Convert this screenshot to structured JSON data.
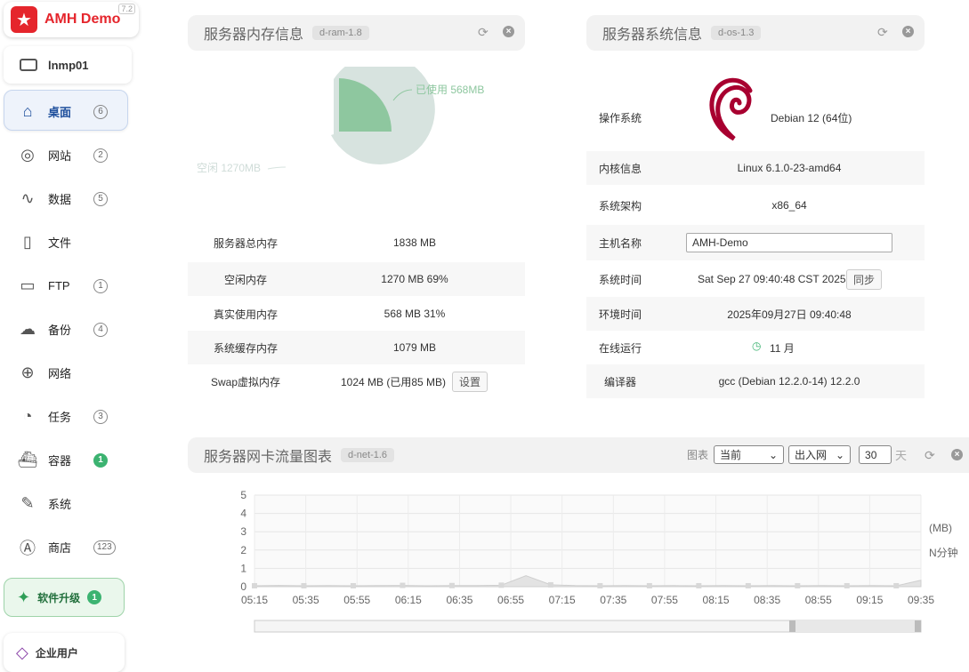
{
  "brand": {
    "title": "AMH Demo",
    "version": "7.2",
    "icon": "star-icon"
  },
  "server": {
    "name": "lnmp01",
    "icon": "server-icon"
  },
  "nav": [
    {
      "label": "桌面",
      "badge": "6",
      "icon": "home-icon",
      "active": true
    },
    {
      "label": "网站",
      "badge": "2",
      "icon": "compass-icon"
    },
    {
      "label": "数据",
      "badge": "5",
      "icon": "dolphin-icon"
    },
    {
      "label": "文件",
      "badge": "",
      "icon": "file-icon"
    },
    {
      "label": "FTP",
      "badge": "1",
      "icon": "ftp-monitor-icon"
    },
    {
      "label": "备份",
      "badge": "4",
      "icon": "cloud-upload-icon"
    },
    {
      "label": "网络",
      "badge": "",
      "icon": "globe-icon"
    },
    {
      "label": "任务",
      "badge": "3",
      "icon": "clock-icon"
    },
    {
      "label": "容器",
      "badge": "1",
      "icon": "docker-icon"
    },
    {
      "label": "系统",
      "badge": "",
      "icon": "wrench-icon"
    },
    {
      "label": "商店",
      "badge": "123",
      "icon": "app-store-icon"
    }
  ],
  "upgrade": {
    "label": "软件升级",
    "badge": "1"
  },
  "enterprise": {
    "label": "企业用户"
  },
  "ram": {
    "title": "服务器内存信息",
    "tag": "d-ram-1.8",
    "pie_used_label": "已使用 568MB",
    "pie_free_label": "空闲 1270MB",
    "rows": [
      {
        "k": "服务器总内存",
        "v": "1838 MB"
      },
      {
        "k": "空闲内存",
        "v": "1270 MB   69%"
      },
      {
        "k": "真实使用内存",
        "v": "568 MB   31%"
      },
      {
        "k": "系统缓存内存",
        "v": "1079 MB"
      },
      {
        "k": "Swap虚拟内存",
        "v": "1024 MB (已用85 MB)"
      }
    ],
    "swap_btn": "设置",
    "colors": {
      "used": "#8ec79f",
      "free": "#d7e3df"
    }
  },
  "os": {
    "title": "服务器系统信息",
    "tag": "d-os-1.3",
    "rows": [
      {
        "k": "操作系统",
        "v": "Debian 12 (64位)"
      },
      {
        "k": "内核信息",
        "v": "Linux 6.1.0-23-amd64"
      },
      {
        "k": "系统架构",
        "v": "x86_64"
      },
      {
        "k": "主机名称",
        "v": "AMH-Demo"
      },
      {
        "k": "系统时间",
        "v": "Sat Sep 27 09:40:48 CST 2025"
      },
      {
        "k": "环境时间",
        "v": "2025年09月27日 09:40:48"
      },
      {
        "k": "在线运行",
        "v": "11 月"
      },
      {
        "k": "编译器",
        "v": "gcc (Debian 12.2.0-14) 12.2.0"
      }
    ],
    "sync_btn": "同步",
    "debian_logo_color": "#a80030"
  },
  "net": {
    "title": "服务器网卡流量图表",
    "tag": "d-net-1.6",
    "chart_label": "图表",
    "range_select": "当前",
    "dir_select": "出入网",
    "days_value": "30",
    "days_unit": "天",
    "unit_label": "(MB)",
    "interval_label": "N分钟"
  },
  "chart_data": {
    "type": "area",
    "x": [
      "05:15",
      "05:25",
      "05:35",
      "05:45",
      "05:55",
      "06:05",
      "06:15",
      "06:25",
      "06:35",
      "06:45",
      "06:55",
      "07:05",
      "07:15",
      "07:25",
      "07:35",
      "07:45",
      "07:55",
      "08:05",
      "08:15",
      "08:25",
      "08:35",
      "08:45",
      "08:55",
      "09:05",
      "09:15",
      "09:25",
      "09:35",
      "09:40"
    ],
    "xticks": [
      "05:15",
      "05:35",
      "05:55",
      "06:15",
      "06:35",
      "06:55",
      "07:15",
      "07:35",
      "07:55",
      "08:15",
      "08:35",
      "08:55",
      "09:15",
      "09:35"
    ],
    "series": [
      {
        "values": [
          0.05,
          0.07,
          0.05,
          0.06,
          0.05,
          0.06,
          0.07,
          0.05,
          0.06,
          0.06,
          0.08,
          0.6,
          0.1,
          0.06,
          0.05,
          0.06,
          0.05,
          0.06,
          0.05,
          0.06,
          0.05,
          0.06,
          0.05,
          0.06,
          0.05,
          0.06,
          0.05,
          0.35
        ]
      }
    ],
    "ylim": [
      0,
      5
    ],
    "yticks": [
      0,
      1,
      2,
      3,
      4,
      5
    ],
    "ylabel": "(MB)",
    "grid": true
  }
}
